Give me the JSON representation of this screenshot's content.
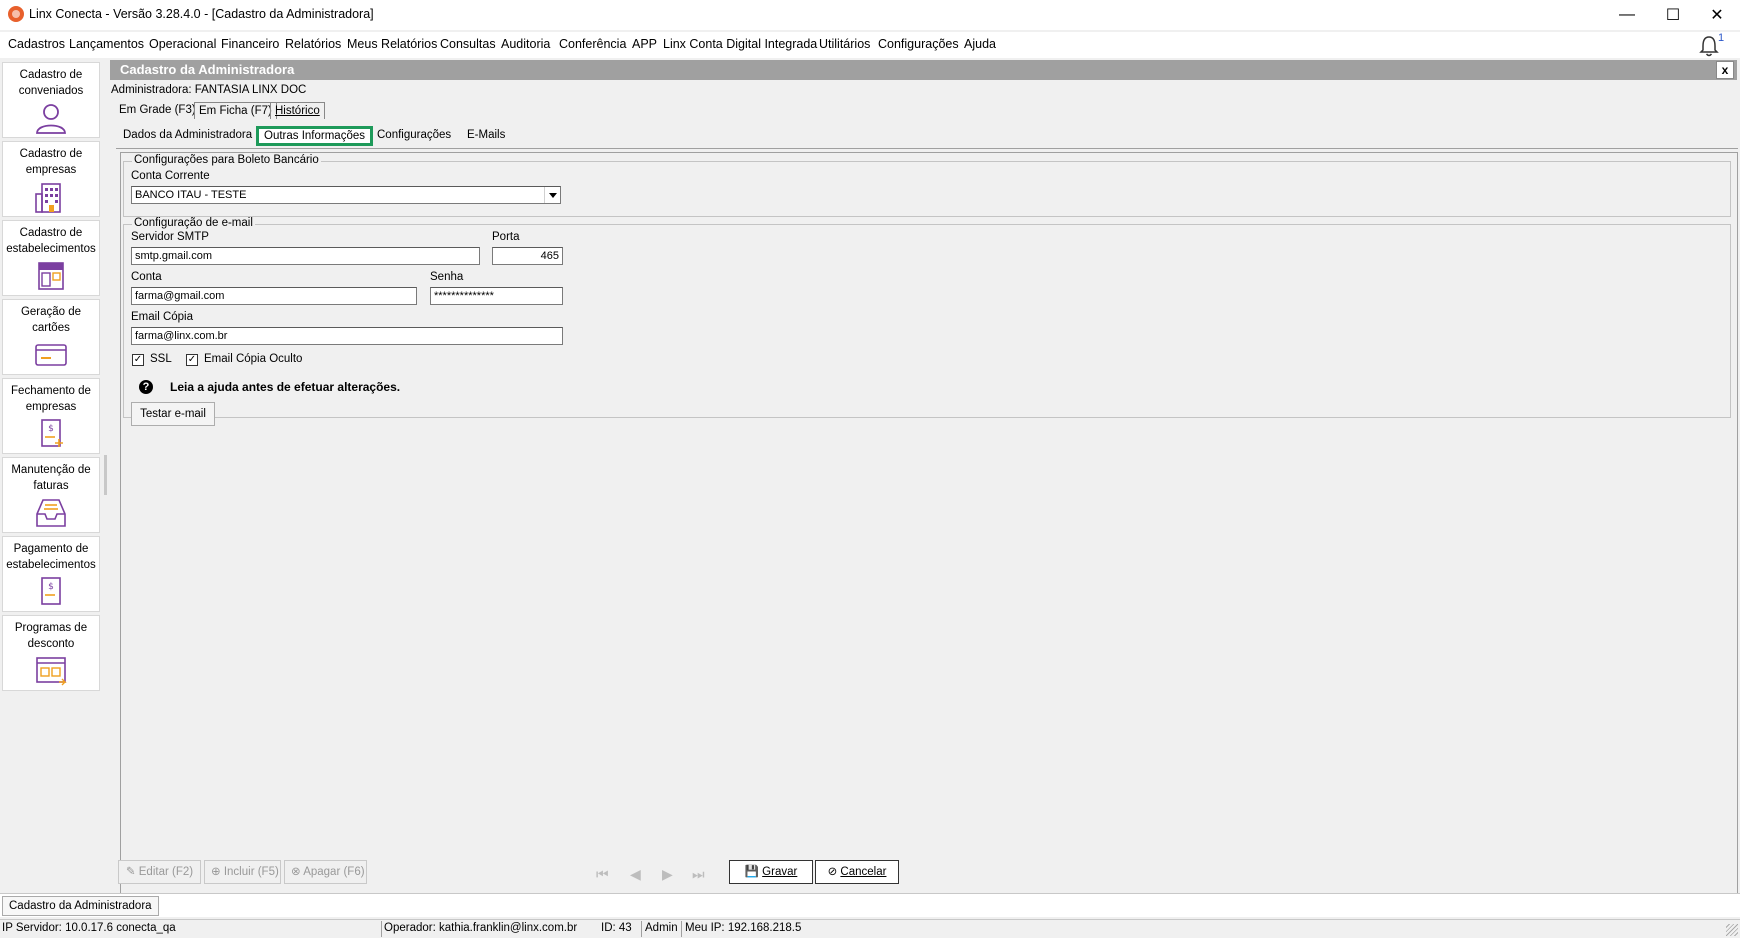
{
  "window": {
    "title": "Linx Conecta - Versão 3.28.4.0 - [Cadastro da Administradora]",
    "minimize": "—",
    "maximize": "☐",
    "close": "✕"
  },
  "menu": {
    "items": [
      "Cadastros",
      "Lançamentos",
      "Operacional",
      "Financeiro",
      "Relatórios",
      "Meus Relatórios",
      "Consultas",
      "Auditoria",
      "Conferência",
      "APP",
      "Linx Conta Digital Integrada",
      "Utilitários",
      "Configurações",
      "Ajuda"
    ],
    "notification_count": "1"
  },
  "sidebar": {
    "items": [
      {
        "label": "Cadastro de conveniados",
        "icon": "user-icon"
      },
      {
        "label": "Cadastro de empresas",
        "icon": "building-icon"
      },
      {
        "label": "Cadastro de estabelecimentos",
        "icon": "store-icon"
      },
      {
        "label": "Geração de cartões",
        "icon": "card-icon"
      },
      {
        "label": "Fechamento de empresas",
        "icon": "invoice-icon"
      },
      {
        "label": "Manutenção de faturas",
        "icon": "inbox-icon"
      },
      {
        "label": "Pagamento de estabelecimentos",
        "icon": "payment-icon"
      },
      {
        "label": "Programas de desconto",
        "icon": "discount-icon"
      }
    ],
    "accent_color": "#7b3fa0",
    "highlight_color": "#f0a020"
  },
  "panel": {
    "title": "Cadastro da Administradora",
    "close_label": "x",
    "admin_line": "Administradora: FANTASIA LINX DOC",
    "view_tabs": [
      "Em Grade (F3)",
      "Em Ficha (F7)",
      "Histórico"
    ],
    "sub_tabs": [
      "Dados da Administradora",
      "Outras Informações",
      "Configurações",
      "E-Mails"
    ]
  },
  "boleto": {
    "group_title": "Configurações para Boleto Bancário",
    "conta_label": "Conta Corrente",
    "conta_value": "BANCO ITAU - TESTE"
  },
  "email": {
    "group_title": "Configuração de e-mail",
    "smtp_label": "Servidor SMTP",
    "smtp_value": "smtp.gmail.com",
    "porta_label": "Porta",
    "porta_value": "465",
    "conta_label": "Conta",
    "conta_value": "farma@gmail.com",
    "senha_label": "Senha",
    "senha_value": "**************",
    "copia_label": "Email Cópia",
    "copia_value": "farma@linx.com.br",
    "ssl_label": "SSL",
    "ssl_checked": true,
    "oculto_label": "Email Cópia Oculto",
    "oculto_checked": true,
    "help_text": "Leia a ajuda antes de efetuar alterações.",
    "test_button": "Testar e-mail"
  },
  "toolbar": {
    "editar": "Editar (F2)",
    "incluir": "Incluir (F5)",
    "apagar": "Apagar (F6)",
    "gravar": "Gravar",
    "cancelar": "Cancelar"
  },
  "taskbar": {
    "tab": "Cadastro da Administradora"
  },
  "status": {
    "server": "IP Servidor: 10.0.17.6 conecta_qa",
    "operador": "Operador: kathia.franklin@linx.com.br",
    "id": "ID: 43",
    "perfil": "Admin",
    "ip": "Meu IP: 192.168.218.5"
  }
}
